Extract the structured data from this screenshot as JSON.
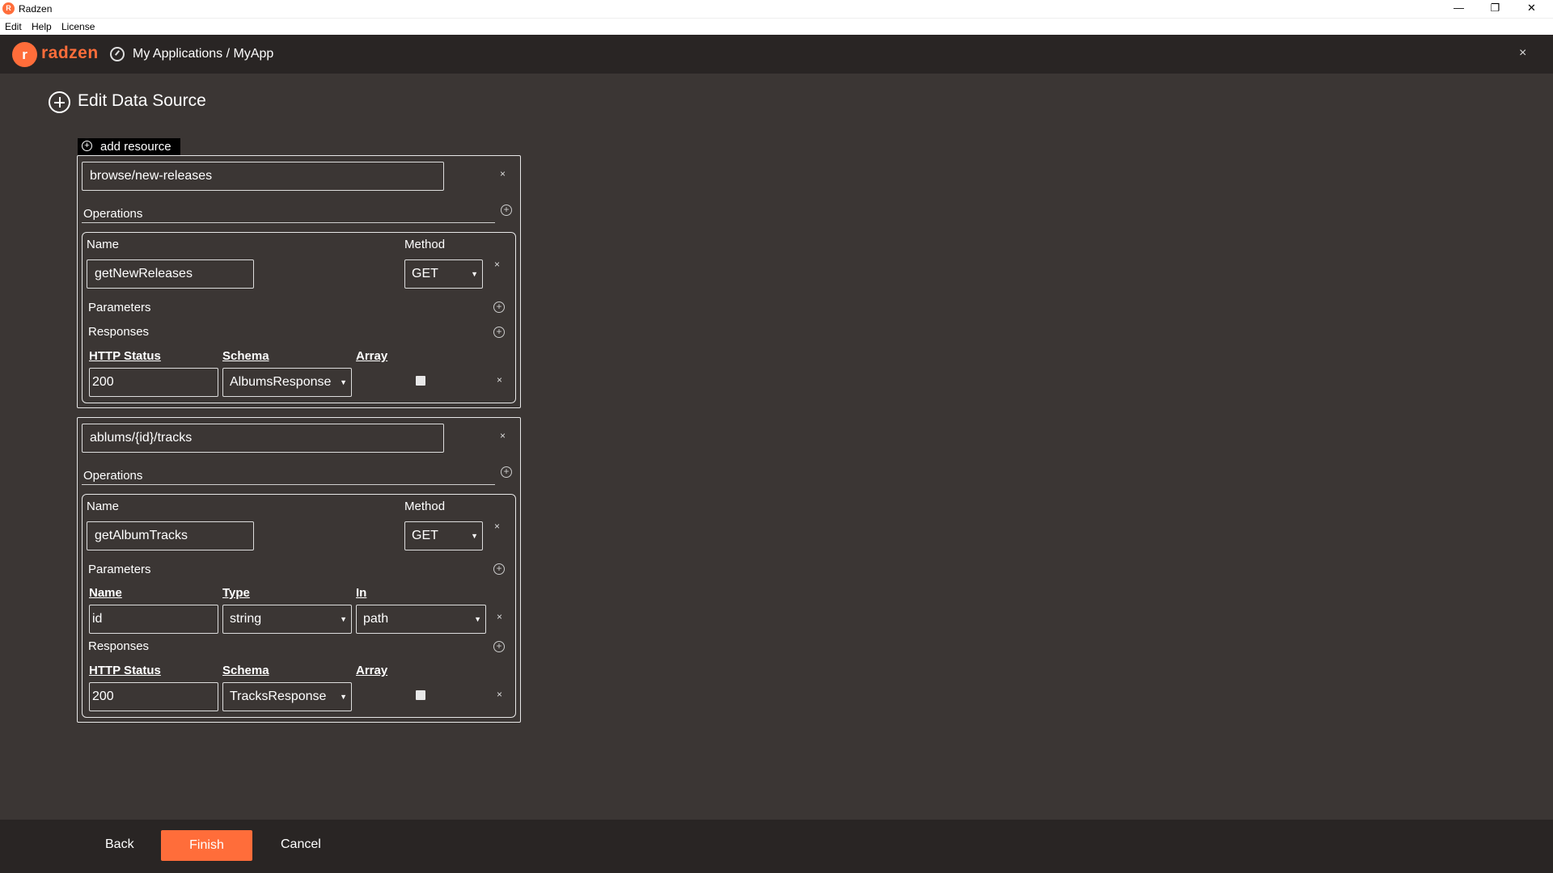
{
  "window": {
    "title": "Radzen",
    "icon_letter": "R",
    "minimize_icon": "minimize-icon",
    "maximize_icon": "restore-icon",
    "close_icon": "close-icon"
  },
  "menu": {
    "items": [
      "Edit",
      "Help",
      "License"
    ]
  },
  "header": {
    "logo_text": "radzen",
    "breadcrumb": "My Applications / MyApp",
    "brand_color": "#ff6d3a"
  },
  "page": {
    "title": "Edit Data Source"
  },
  "add_resource_label": "add resource",
  "resources": [
    {
      "path": "browse/new-releases",
      "operations_label": "Operations",
      "operation": {
        "name_label": "Name",
        "method_label": "Method",
        "name": "getNewReleases",
        "method": "GET",
        "parameters_label": "Parameters",
        "responses_label": "Responses",
        "response_headers": {
          "status": "HTTP Status",
          "schema": "Schema",
          "array": "Array"
        },
        "responses": [
          {
            "status": "200",
            "schema": "AlbumsResponse",
            "array": false
          }
        ]
      }
    },
    {
      "path": "ablums/{id}/tracks",
      "operations_label": "Operations",
      "operation": {
        "name_label": "Name",
        "method_label": "Method",
        "name": "getAlbumTracks",
        "method": "GET",
        "parameters_label": "Parameters",
        "parameter_headers": {
          "name": "Name",
          "type": "Type",
          "in": "In"
        },
        "parameters": [
          {
            "name": "id",
            "type": "string",
            "in": "path"
          }
        ],
        "responses_label": "Responses",
        "response_headers": {
          "status": "HTTP Status",
          "schema": "Schema",
          "array": "Array"
        },
        "responses": [
          {
            "status": "200",
            "schema": "TracksResponse",
            "array": false
          }
        ]
      }
    }
  ],
  "footer": {
    "back": "Back",
    "finish": "Finish",
    "cancel": "Cancel"
  }
}
